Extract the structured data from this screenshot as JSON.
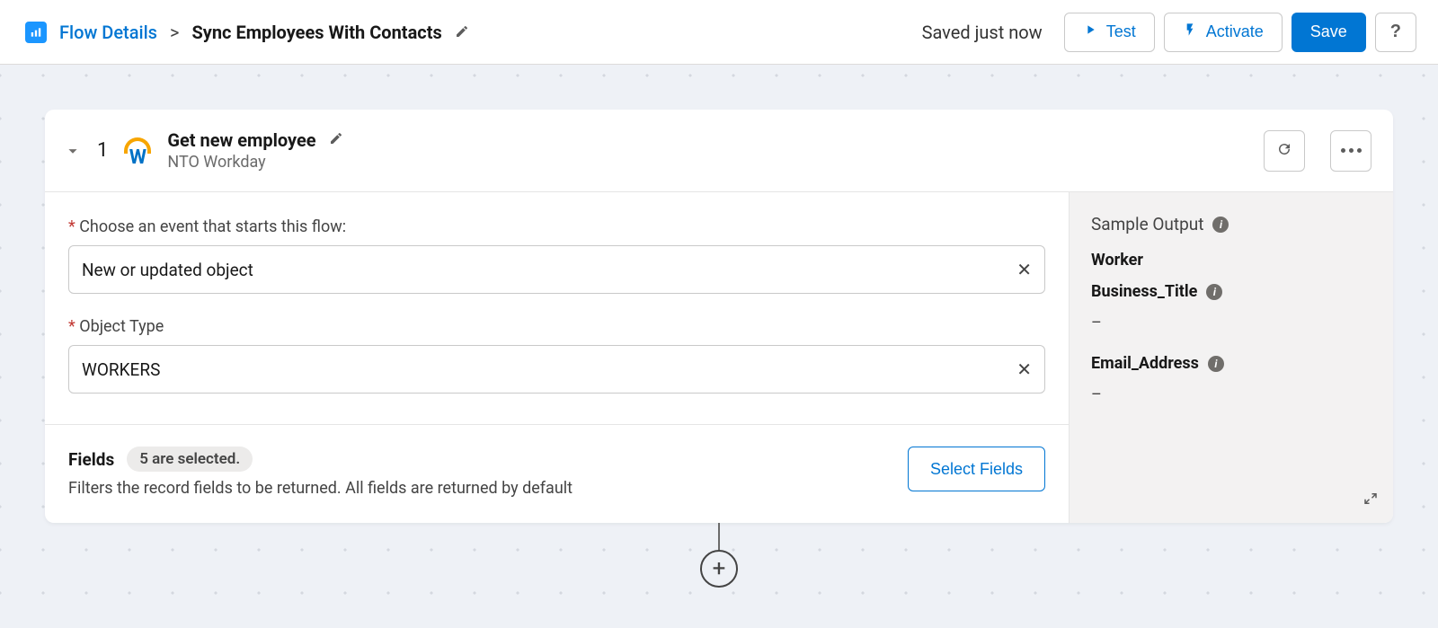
{
  "header": {
    "breadcrumb_link": "Flow Details",
    "separator": ">",
    "flow_name": "Sync Employees With Contacts",
    "status": "Saved just now",
    "test_label": "Test",
    "activate_label": "Activate",
    "save_label": "Save",
    "help_label": "?"
  },
  "step": {
    "number": "1",
    "title": "Get new employee",
    "connector": "NTO Workday",
    "event_label": "Choose an event that starts this flow:",
    "event_value": "New or updated object",
    "object_type_label": "Object Type",
    "object_type_value": "WORKERS",
    "fields_title": "Fields",
    "fields_badge": "5 are selected.",
    "fields_desc": "Filters the record fields to be returned. All fields are returned by default",
    "select_fields_label": "Select Fields"
  },
  "sample": {
    "title": "Sample Output",
    "root_key": "Worker",
    "keys": [
      {
        "name": "Business_Title",
        "value": "–"
      },
      {
        "name": "Email_Address",
        "value": "–"
      }
    ]
  },
  "icons": {
    "flow_details": "flow-details-icon",
    "pencil": "pencil-icon",
    "play": "play-icon",
    "bolt": "bolt-icon",
    "chevron_down": "chevron-down-icon",
    "refresh": "refresh-icon",
    "more": "more-icon",
    "clear": "clear-icon",
    "info": "info-icon",
    "expand": "expand-icon",
    "plus": "plus-icon"
  }
}
